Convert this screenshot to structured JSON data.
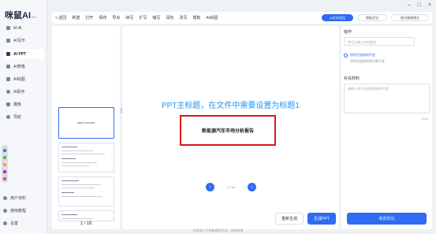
{
  "app": {
    "logo": "咪鼠AI",
    "version": "2.0",
    "window_controls": [
      "–",
      "□",
      "×"
    ]
  },
  "sidebar": {
    "items": [
      {
        "label": "M-AI",
        "icon": "chat-icon"
      },
      {
        "label": "AI写作",
        "icon": "pen-icon"
      },
      {
        "label": "AI PPT",
        "icon": "ppt-icon",
        "active": true
      },
      {
        "label": "AI表格",
        "icon": "table-icon"
      },
      {
        "label": "AI绘图",
        "icon": "image-icon"
      },
      {
        "label": "AI助手",
        "icon": "robot-icon"
      },
      {
        "label": "模板",
        "icon": "template-icon"
      },
      {
        "label": "导航",
        "icon": "navigation-icon"
      }
    ],
    "bottom_items": [
      {
        "label": "用户资料",
        "icon": "user-icon"
      },
      {
        "label": "使用教程",
        "icon": "help-icon"
      },
      {
        "label": "设置",
        "icon": "gear-icon"
      }
    ]
  },
  "toolbar": {
    "back_label": "< 返回",
    "items": [
      "新建",
      "打开",
      "保存",
      "导出",
      "续写",
      "扩写",
      "缩写",
      "润色",
      "改写",
      "模板",
      "AI绘图"
    ],
    "mode_buttons": [
      {
        "label": "AI文本优化",
        "active": true
      },
      {
        "label": "模板优化",
        "active": false
      },
      {
        "label": "格式编辑建议",
        "active": false
      }
    ]
  },
  "slides": {
    "thumbnails": [
      {
        "title": "新能源汽车市场分析报告",
        "selected": true
      },
      {
        "title": "",
        "selected": false
      },
      {
        "title": "",
        "selected": false
      },
      {
        "title": "",
        "selected": false
      }
    ],
    "page_counter": "1 / 16"
  },
  "canvas": {
    "heading": "PPT主标题，在文件中需要设置为标题1",
    "slide_title": "新能源汽车市场分析报告",
    "pager": {
      "prev": "‹",
      "text": "1 / 16",
      "next": "›"
    },
    "buttons": {
      "regenerate": "重新生成",
      "generate": "生成PPT"
    }
  },
  "right_panel": {
    "operation_title": "操作",
    "operation_placeholder": "你可以输入你的要求",
    "radio_label": "保持页面结构不变",
    "radio_desc": "保持页面结构和字数不变",
    "material_title": "补充材料",
    "material_placeholder": "请输入你可以给我的参考内容",
    "char_count": "0/2000",
    "confirm_button": "单页优化"
  },
  "footer": {
    "disclaimer": "内容由人工智能模型生成，仅供参考"
  },
  "colors": {
    "accent": "#2f6bf3",
    "heading": "#2196f3",
    "highlight_box": "#d71a1a"
  }
}
